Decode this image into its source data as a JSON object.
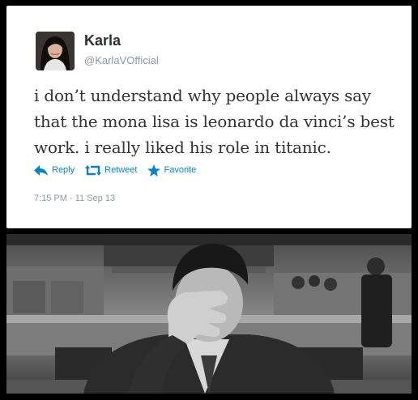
{
  "tweet": {
    "name": "Karla",
    "handle": "@KarlaVOfficial",
    "text": "i don’t understand why people always say that the mona lisa is leonardo da vinci’s best work. i really liked his role in titanic.",
    "actions": {
      "reply": "Reply",
      "retweet": "Retweet",
      "favorite": "Favorite"
    },
    "timestamp": "7:15 PM - 11 Sep 13",
    "accent_color": "#0a84c0"
  },
  "photo": {
    "style": "black-and-white",
    "icons": [
      "facepalm-photo"
    ]
  }
}
